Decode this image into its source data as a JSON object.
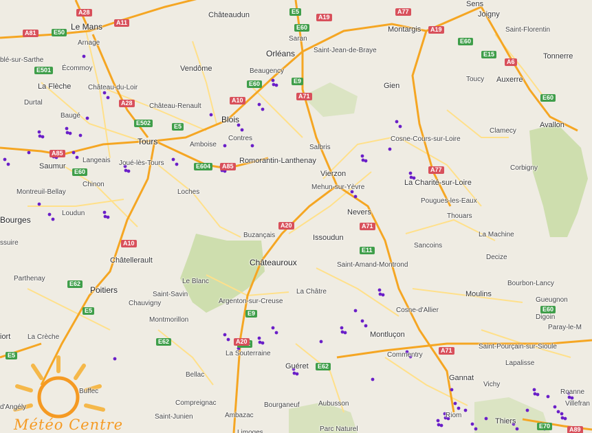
{
  "map": {
    "cities": [
      {
        "name": "Le Mans",
        "size": "big"
      },
      {
        "name": "Châteaudun",
        "size": "med"
      },
      {
        "name": "Saran",
        "size": "small"
      },
      {
        "name": "Sens",
        "size": "med"
      },
      {
        "name": "Montargis",
        "size": "med"
      },
      {
        "name": "Joigny",
        "size": "med"
      },
      {
        "name": "Saint-Florentin",
        "size": "small"
      },
      {
        "name": "Orléans",
        "size": "big"
      },
      {
        "name": "Saint-Jean-de-Braye",
        "size": "small"
      },
      {
        "name": "Tonnerre",
        "size": "med"
      },
      {
        "name": "Arnage",
        "size": "small"
      },
      {
        "name": "blé-sur-Sarthe",
        "size": "small"
      },
      {
        "name": "Écommoy",
        "size": "small"
      },
      {
        "name": "Vendôme",
        "size": "med"
      },
      {
        "name": "Beaugency",
        "size": "small"
      },
      {
        "name": "Toucy",
        "size": "small"
      },
      {
        "name": "Auxerre",
        "size": "med"
      },
      {
        "name": "La Flèche",
        "size": "med"
      },
      {
        "name": "Château-du-Loir",
        "size": "small"
      },
      {
        "name": "Gien",
        "size": "med"
      },
      {
        "name": "Durtal",
        "size": "small"
      },
      {
        "name": "Château-Renault",
        "size": "small"
      },
      {
        "name": "Blois",
        "size": "big"
      },
      {
        "name": "Baugé",
        "size": "small"
      },
      {
        "name": "Clamecy",
        "size": "small"
      },
      {
        "name": "Avallon",
        "size": "med"
      },
      {
        "name": "Tours",
        "size": "big"
      },
      {
        "name": "Amboise",
        "size": "small"
      },
      {
        "name": "Contres",
        "size": "small"
      },
      {
        "name": "Salbris",
        "size": "small"
      },
      {
        "name": "Cosne-Cours-sur-Loire",
        "size": "small"
      },
      {
        "name": "Saumur",
        "size": "med"
      },
      {
        "name": "Langeais",
        "size": "small"
      },
      {
        "name": "Joué-lès-Tours",
        "size": "small"
      },
      {
        "name": "Romorantin-Lanthenay",
        "size": "med"
      },
      {
        "name": "Corbigny",
        "size": "small"
      },
      {
        "name": "Vierzon",
        "size": "med"
      },
      {
        "name": "Chinon",
        "size": "small"
      },
      {
        "name": "Mehun-sur-Yèvre",
        "size": "small"
      },
      {
        "name": "La Charité-sur-Loire",
        "size": "med"
      },
      {
        "name": "Montreuil-Bellay",
        "size": "small"
      },
      {
        "name": "Loches",
        "size": "small"
      },
      {
        "name": "Pougues-les-Eaux",
        "size": "small"
      },
      {
        "name": "Loudun",
        "size": "small"
      },
      {
        "name": "Bourges",
        "size": "big"
      },
      {
        "name": "Nevers",
        "size": "med"
      },
      {
        "name": "Thouars",
        "size": "small"
      },
      {
        "name": "Buzançais",
        "size": "small"
      },
      {
        "name": "Issoudun",
        "size": "med"
      },
      {
        "name": "La Machine",
        "size": "small"
      },
      {
        "name": "ssuire",
        "size": "small"
      },
      {
        "name": "Sancoins",
        "size": "small"
      },
      {
        "name": "Châtellerault",
        "size": "med"
      },
      {
        "name": "Châteauroux",
        "size": "big"
      },
      {
        "name": "Saint-Amand-Montrond",
        "size": "small"
      },
      {
        "name": "Decize",
        "size": "small"
      },
      {
        "name": "Parthenay",
        "size": "small"
      },
      {
        "name": "Le Blanc",
        "size": "small"
      },
      {
        "name": "Bourbon-Lancy",
        "size": "small"
      },
      {
        "name": "Poitiers",
        "size": "big"
      },
      {
        "name": "Saint-Savin",
        "size": "small"
      },
      {
        "name": "La Châtre",
        "size": "small"
      },
      {
        "name": "Moulins",
        "size": "med"
      },
      {
        "name": "Gueugnon",
        "size": "small"
      },
      {
        "name": "Chauvigny",
        "size": "small"
      },
      {
        "name": "Argenton-sur-Creuse",
        "size": "small"
      },
      {
        "name": "Cosne-d'Allier",
        "size": "small"
      },
      {
        "name": "Digoin",
        "size": "small"
      },
      {
        "name": "Montmorillon",
        "size": "small"
      },
      {
        "name": "Paray-le-M",
        "size": "small"
      },
      {
        "name": "iort",
        "size": "med"
      },
      {
        "name": "La Crèche",
        "size": "small"
      },
      {
        "name": "Montluçon",
        "size": "med"
      },
      {
        "name": "Saint-Pourçain-sur-Sioule",
        "size": "small"
      },
      {
        "name": "La Souterraine",
        "size": "small"
      },
      {
        "name": "Commentry",
        "size": "small"
      },
      {
        "name": "Lapalisse",
        "size": "small"
      },
      {
        "name": "Guéret",
        "size": "med"
      },
      {
        "name": "Bellac",
        "size": "small"
      },
      {
        "name": "Gannat",
        "size": "med"
      },
      {
        "name": "Buffec",
        "size": "small"
      },
      {
        "name": "Vichy",
        "size": "small"
      },
      {
        "name": "Roanne",
        "size": "small"
      },
      {
        "name": "d'Angély",
        "size": "small"
      },
      {
        "name": "Compreignac",
        "size": "small"
      },
      {
        "name": "Bourganeuf",
        "size": "small"
      },
      {
        "name": "Aubusson",
        "size": "small"
      },
      {
        "name": "Villefran",
        "size": "small"
      },
      {
        "name": "Ambazac",
        "size": "small"
      },
      {
        "name": "Saint-Junien",
        "size": "small"
      },
      {
        "name": "Thiers",
        "size": "med"
      },
      {
        "name": "Riom",
        "size": "small"
      },
      {
        "name": "Parc Naturel",
        "size": "small"
      },
      {
        "name": "Limoges",
        "size": "small"
      }
    ],
    "shields": [
      {
        "ref": "A28",
        "style": "red"
      },
      {
        "ref": "A11",
        "style": "red"
      },
      {
        "ref": "E5",
        "style": "green"
      },
      {
        "ref": "A19",
        "style": "red"
      },
      {
        "ref": "A77",
        "style": "red"
      },
      {
        "ref": "A81",
        "style": "red"
      },
      {
        "ref": "E50",
        "style": "green"
      },
      {
        "ref": "E60",
        "style": "green"
      },
      {
        "ref": "A19",
        "style": "red"
      },
      {
        "ref": "E60",
        "style": "green"
      },
      {
        "ref": "E15",
        "style": "green"
      },
      {
        "ref": "A6",
        "style": "red"
      },
      {
        "ref": "E501",
        "style": "green"
      },
      {
        "ref": "E60",
        "style": "green"
      },
      {
        "ref": "E9",
        "style": "green"
      },
      {
        "ref": "A71",
        "style": "red"
      },
      {
        "ref": "A28",
        "style": "red"
      },
      {
        "ref": "A10",
        "style": "red"
      },
      {
        "ref": "E60",
        "style": "green"
      },
      {
        "ref": "E502",
        "style": "green"
      },
      {
        "ref": "E5",
        "style": "green"
      },
      {
        "ref": "A85",
        "style": "red"
      },
      {
        "ref": "E604",
        "style": "green"
      },
      {
        "ref": "A85",
        "style": "red"
      },
      {
        "ref": "E60",
        "style": "green"
      },
      {
        "ref": "A77",
        "style": "red"
      },
      {
        "ref": "A71",
        "style": "red"
      },
      {
        "ref": "A20",
        "style": "red"
      },
      {
        "ref": "E11",
        "style": "green"
      },
      {
        "ref": "A10",
        "style": "red"
      },
      {
        "ref": "E62",
        "style": "green"
      },
      {
        "ref": "E5",
        "style": "green"
      },
      {
        "ref": "E62",
        "style": "green"
      },
      {
        "ref": "E60",
        "style": "green"
      },
      {
        "ref": "E9",
        "style": "green"
      },
      {
        "ref": "A20",
        "style": "red"
      },
      {
        "ref": "E62",
        "style": "green"
      },
      {
        "ref": "A71",
        "style": "red"
      },
      {
        "ref": "E62",
        "style": "green"
      },
      {
        "ref": "E5",
        "style": "green"
      },
      {
        "ref": "E70",
        "style": "green"
      },
      {
        "ref": "A89",
        "style": "red"
      }
    ],
    "colors": {
      "land": "#efece3",
      "motorway": "#f5a623",
      "road": "#ffe08a",
      "green_area": "#c8dca4",
      "lightning": "#6a1fc8",
      "logo": "#f59a23"
    }
  },
  "logo": {
    "text": "Météo Centre"
  }
}
